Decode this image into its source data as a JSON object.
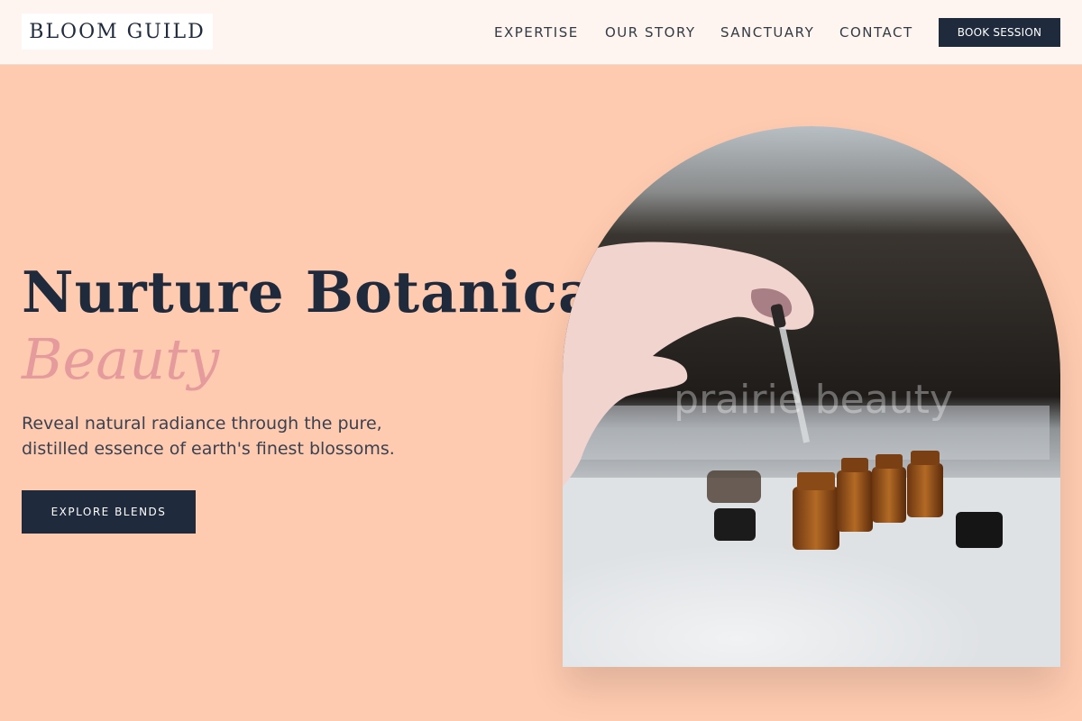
{
  "header": {
    "logo": "BLOOM GUILD",
    "nav": [
      {
        "label": "EXPERTISE"
      },
      {
        "label": "OUR STORY"
      },
      {
        "label": "SANCTUARY"
      },
      {
        "label": "CONTACT"
      }
    ],
    "cta_label": "BOOK SESSION"
  },
  "hero": {
    "title": "Nurture Botanical",
    "title_accent": "Beauty",
    "subtitle_line1": "Reveal natural radiance through the pure,",
    "subtitle_line2": "distilled essence of earth's finest blossoms.",
    "cta_label": "EXPLORE BLENDS"
  },
  "image": {
    "watermark": "prairie beauty",
    "icon": "dropper-bottles-photo"
  },
  "colors": {
    "background": "#ffcbb0",
    "header_bg": "#fff5f0",
    "navy": "#1f2a3c",
    "accent_pink": "#e59a9c"
  }
}
